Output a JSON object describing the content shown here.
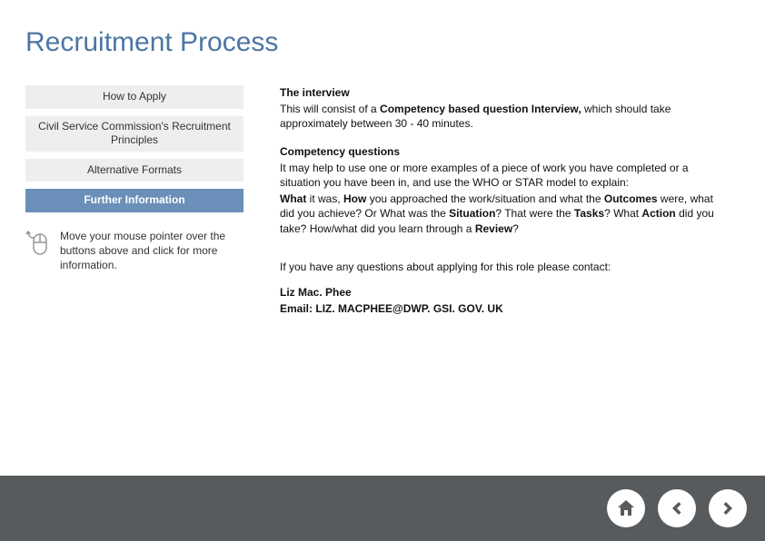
{
  "title": "Recruitment Process",
  "nav": {
    "how_to_apply": "How to Apply",
    "civil_service": "Civil Service Commission's Recruitment Principles",
    "alt_formats": "Alternative Formats",
    "further_info": "Further Information"
  },
  "hint": "Move your mouse pointer over the buttons above and click for more information.",
  "content": {
    "interview_heading": "The interview",
    "interview_line1_a": "This will consist of a ",
    "interview_line1_b": "Competency based question Interview,",
    "interview_line1_c": " which should take approximately between 30 - 40 minutes.",
    "comp_heading": "Competency questions",
    "comp_p1": "It may help to use one or more examples of a piece of work you have completed or a situation you have been in, and use the WHO or STAR model to explain:",
    "comp_what": "What",
    "comp_seg1": " it was, ",
    "comp_how": "How",
    "comp_seg2": " you approached the work/situation and what the ",
    "comp_outcomes": "Outcomes",
    "comp_seg3": " were, what did you achieve? Or What was the ",
    "comp_situation": "Situation",
    "comp_seg4": "? That were the ",
    "comp_tasks": "Tasks",
    "comp_seg5": "? What ",
    "comp_action": "Action",
    "comp_seg6": " did you take? How/what did you learn through a ",
    "comp_review": "Review",
    "comp_seg7": "?",
    "contact_intro": "If you have any questions about applying for this role please contact:",
    "contact_name": "Liz Mac. Phee",
    "contact_email_label": "Email: ",
    "contact_email": "LIZ. MACPHEE@DWP. GSI. GOV. UK"
  }
}
